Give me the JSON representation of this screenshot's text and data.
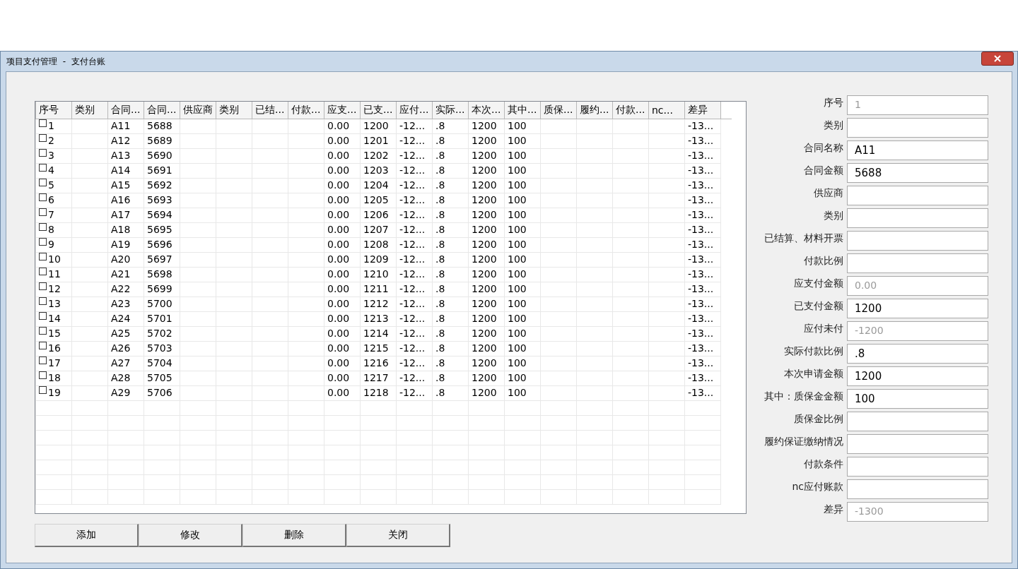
{
  "window": {
    "title": "项目支付管理  -  支付台账"
  },
  "table": {
    "columns": [
      "序号",
      "类别",
      "合同...",
      "合同...",
      "供应商",
      "类别",
      "已结...",
      "付款...",
      "应支...",
      "已支...",
      "应付...",
      "实际...",
      "本次...",
      "其中...",
      "质保...",
      "履约...",
      "付款...",
      "nc...",
      "差异"
    ],
    "rows": [
      {
        "checked": false,
        "cells": [
          "1",
          null,
          "A11",
          "5688",
          null,
          null,
          null,
          null,
          "0.00",
          "1200",
          "-12...",
          ".8",
          "1200",
          "100",
          null,
          null,
          null,
          null,
          "-13..."
        ]
      },
      {
        "checked": false,
        "cells": [
          "2",
          null,
          "A12",
          "5689",
          null,
          null,
          null,
          null,
          "0.00",
          "1201",
          "-12...",
          ".8",
          "1200",
          "100",
          null,
          null,
          null,
          null,
          "-13..."
        ]
      },
      {
        "checked": false,
        "cells": [
          "3",
          null,
          "A13",
          "5690",
          null,
          null,
          null,
          null,
          "0.00",
          "1202",
          "-12...",
          ".8",
          "1200",
          "100",
          null,
          null,
          null,
          null,
          "-13..."
        ]
      },
      {
        "checked": false,
        "cells": [
          "4",
          null,
          "A14",
          "5691",
          null,
          null,
          null,
          null,
          "0.00",
          "1203",
          "-12...",
          ".8",
          "1200",
          "100",
          null,
          null,
          null,
          null,
          "-13..."
        ]
      },
      {
        "checked": false,
        "cells": [
          "5",
          null,
          "A15",
          "5692",
          null,
          null,
          null,
          null,
          "0.00",
          "1204",
          "-12...",
          ".8",
          "1200",
          "100",
          null,
          null,
          null,
          null,
          "-13..."
        ]
      },
      {
        "checked": false,
        "cells": [
          "6",
          null,
          "A16",
          "5693",
          null,
          null,
          null,
          null,
          "0.00",
          "1205",
          "-12...",
          ".8",
          "1200",
          "100",
          null,
          null,
          null,
          null,
          "-13..."
        ]
      },
      {
        "checked": false,
        "cells": [
          "7",
          null,
          "A17",
          "5694",
          null,
          null,
          null,
          null,
          "0.00",
          "1206",
          "-12...",
          ".8",
          "1200",
          "100",
          null,
          null,
          null,
          null,
          "-13..."
        ]
      },
      {
        "checked": false,
        "cells": [
          "8",
          null,
          "A18",
          "5695",
          null,
          null,
          null,
          null,
          "0.00",
          "1207",
          "-12...",
          ".8",
          "1200",
          "100",
          null,
          null,
          null,
          null,
          "-13..."
        ]
      },
      {
        "checked": false,
        "cells": [
          "9",
          null,
          "A19",
          "5696",
          null,
          null,
          null,
          null,
          "0.00",
          "1208",
          "-12...",
          ".8",
          "1200",
          "100",
          null,
          null,
          null,
          null,
          "-13..."
        ]
      },
      {
        "checked": false,
        "cells": [
          "10",
          null,
          "A20",
          "5697",
          null,
          null,
          null,
          null,
          "0.00",
          "1209",
          "-12...",
          ".8",
          "1200",
          "100",
          null,
          null,
          null,
          null,
          "-13..."
        ]
      },
      {
        "checked": false,
        "cells": [
          "11",
          null,
          "A21",
          "5698",
          null,
          null,
          null,
          null,
          "0.00",
          "1210",
          "-12...",
          ".8",
          "1200",
          "100",
          null,
          null,
          null,
          null,
          "-13..."
        ]
      },
      {
        "checked": false,
        "cells": [
          "12",
          null,
          "A22",
          "5699",
          null,
          null,
          null,
          null,
          "0.00",
          "1211",
          "-12...",
          ".8",
          "1200",
          "100",
          null,
          null,
          null,
          null,
          "-13..."
        ]
      },
      {
        "checked": false,
        "cells": [
          "13",
          null,
          "A23",
          "5700",
          null,
          null,
          null,
          null,
          "0.00",
          "1212",
          "-12...",
          ".8",
          "1200",
          "100",
          null,
          null,
          null,
          null,
          "-13..."
        ]
      },
      {
        "checked": false,
        "cells": [
          "14",
          null,
          "A24",
          "5701",
          null,
          null,
          null,
          null,
          "0.00",
          "1213",
          "-12...",
          ".8",
          "1200",
          "100",
          null,
          null,
          null,
          null,
          "-13..."
        ]
      },
      {
        "checked": false,
        "cells": [
          "15",
          null,
          "A25",
          "5702",
          null,
          null,
          null,
          null,
          "0.00",
          "1214",
          "-12...",
          ".8",
          "1200",
          "100",
          null,
          null,
          null,
          null,
          "-13..."
        ]
      },
      {
        "checked": false,
        "cells": [
          "16",
          null,
          "A26",
          "5703",
          null,
          null,
          null,
          null,
          "0.00",
          "1215",
          "-12...",
          ".8",
          "1200",
          "100",
          null,
          null,
          null,
          null,
          "-13..."
        ]
      },
      {
        "checked": false,
        "cells": [
          "17",
          null,
          "A27",
          "5704",
          null,
          null,
          null,
          null,
          "0.00",
          "1216",
          "-12...",
          ".8",
          "1200",
          "100",
          null,
          null,
          null,
          null,
          "-13..."
        ]
      },
      {
        "checked": false,
        "cells": [
          "18",
          null,
          "A28",
          "5705",
          null,
          null,
          null,
          null,
          "0.00",
          "1217",
          "-12...",
          ".8",
          "1200",
          "100",
          null,
          null,
          null,
          null,
          "-13..."
        ]
      },
      {
        "checked": false,
        "cells": [
          "19",
          null,
          "A29",
          "5706",
          null,
          null,
          null,
          null,
          "0.00",
          "1218",
          "-12...",
          ".8",
          "1200",
          "100",
          null,
          null,
          null,
          null,
          "-13..."
        ]
      }
    ]
  },
  "form": {
    "fields": [
      {
        "label": "序号",
        "value": "1",
        "disabled": true
      },
      {
        "label": "类别"
      },
      {
        "label": "合同名称",
        "value": "A11",
        "disabled": false
      },
      {
        "label": "合同金额",
        "value": "5688",
        "disabled": false
      },
      {
        "label": "供应商"
      },
      {
        "label": "类别"
      },
      {
        "label": "已结算、材料开票"
      },
      {
        "label": "付款比例"
      },
      {
        "label": "应支付金额",
        "value": "0.00",
        "disabled": true
      },
      {
        "label": "已支付金额",
        "value": "1200",
        "disabled": false
      },
      {
        "label": "应付未付",
        "value": "-1200",
        "disabled": true
      },
      {
        "label": "实际付款比例",
        "value": ".8",
        "disabled": false
      },
      {
        "label": "本次申请金额",
        "value": "1200",
        "disabled": false
      },
      {
        "label": "其中：质保金金额",
        "value": "100",
        "disabled": false
      },
      {
        "label": "质保金比例"
      },
      {
        "label": "履约保证缴纳情况"
      },
      {
        "label": "付款条件"
      },
      {
        "label": "nc应付账款"
      },
      {
        "label": "差异",
        "value": "-1300",
        "disabled": true
      }
    ]
  },
  "buttons": [
    "添加",
    "修改",
    "删除",
    "关闭"
  ]
}
